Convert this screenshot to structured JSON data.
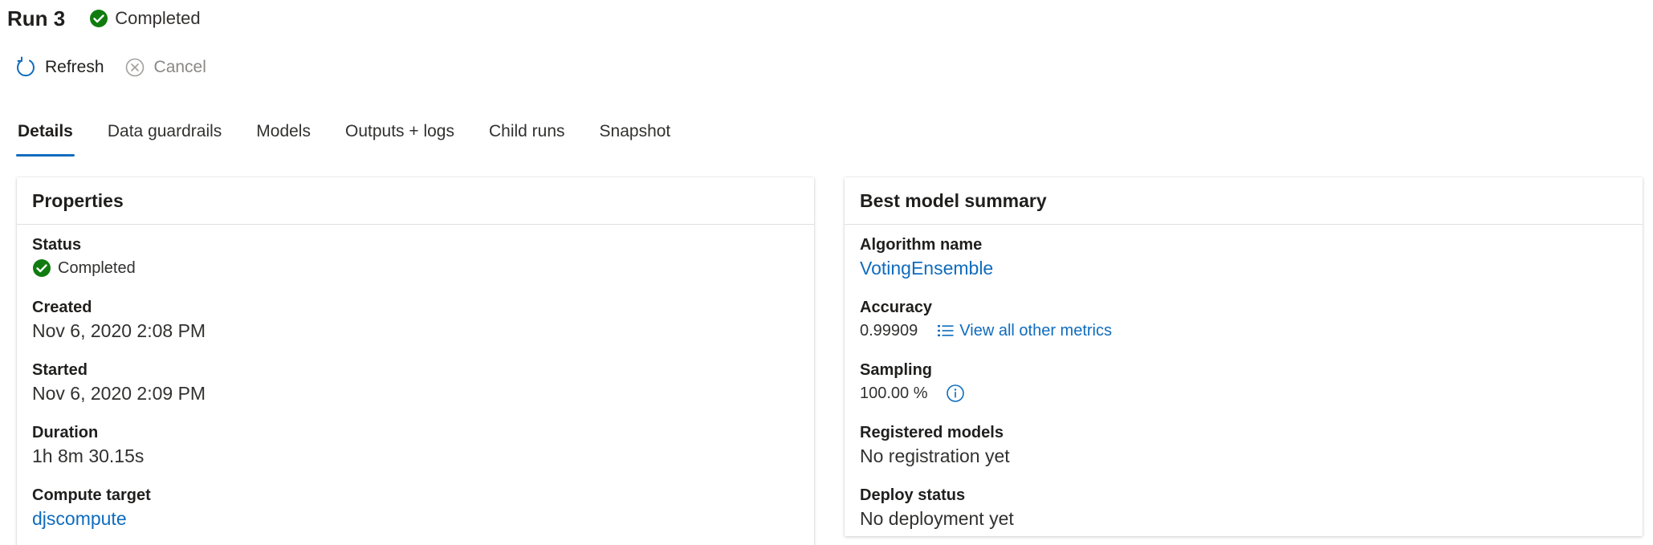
{
  "header": {
    "title": "Run 3",
    "status": "Completed"
  },
  "toolbar": {
    "refresh_label": "Refresh",
    "cancel_label": "Cancel"
  },
  "tabs": [
    {
      "label": "Details",
      "active": true
    },
    {
      "label": "Data guardrails",
      "active": false
    },
    {
      "label": "Models",
      "active": false
    },
    {
      "label": "Outputs + logs",
      "active": false
    },
    {
      "label": "Child runs",
      "active": false
    },
    {
      "label": "Snapshot",
      "active": false
    }
  ],
  "properties": {
    "title": "Properties",
    "status_label": "Status",
    "status_value": "Completed",
    "created_label": "Created",
    "created_value": "Nov 6, 2020 2:08 PM",
    "started_label": "Started",
    "started_value": "Nov 6, 2020 2:09 PM",
    "duration_label": "Duration",
    "duration_value": "1h 8m 30.15s",
    "compute_label": "Compute target",
    "compute_value": "djscompute"
  },
  "best_model": {
    "title": "Best model summary",
    "algorithm_label": "Algorithm name",
    "algorithm_value": "VotingEnsemble",
    "accuracy_label": "Accuracy",
    "accuracy_value": "0.99909",
    "metrics_link": "View all other metrics",
    "sampling_label": "Sampling",
    "sampling_value": "100.00 %",
    "registered_label": "Registered models",
    "registered_value": "No registration yet",
    "deploy_label": "Deploy status",
    "deploy_value": "No deployment yet"
  },
  "colors": {
    "accent": "#0f6cbd",
    "success": "#107c10",
    "disabled": "#8a8886"
  },
  "icons": {
    "status": "check-circle-icon",
    "refresh": "refresh-icon",
    "cancel": "cancel-circle-icon",
    "metrics": "list-icon",
    "info": "info-icon"
  }
}
